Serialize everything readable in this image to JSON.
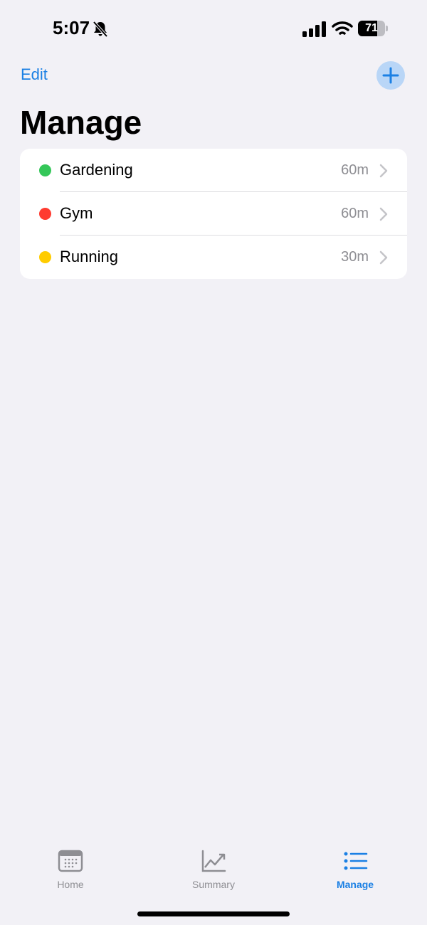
{
  "status_bar": {
    "time": "5:07",
    "battery": "71",
    "battery_level": 0.71
  },
  "nav": {
    "edit_label": "Edit",
    "title": "Manage"
  },
  "items": [
    {
      "label": "Gardening",
      "duration": "60m",
      "color": "#34c759"
    },
    {
      "label": "Gym",
      "duration": "60m",
      "color": "#ff3b30"
    },
    {
      "label": "Running",
      "duration": "30m",
      "color": "#ffcc00"
    }
  ],
  "tabs": [
    {
      "label": "Home",
      "icon": "calendar-icon",
      "active": false
    },
    {
      "label": "Summary",
      "icon": "chart-icon",
      "active": false
    },
    {
      "label": "Manage",
      "icon": "list-icon",
      "active": true
    }
  ],
  "colors": {
    "accent": "#1b80e4",
    "background": "#f2f1f6",
    "inactive": "#8e8e93"
  }
}
